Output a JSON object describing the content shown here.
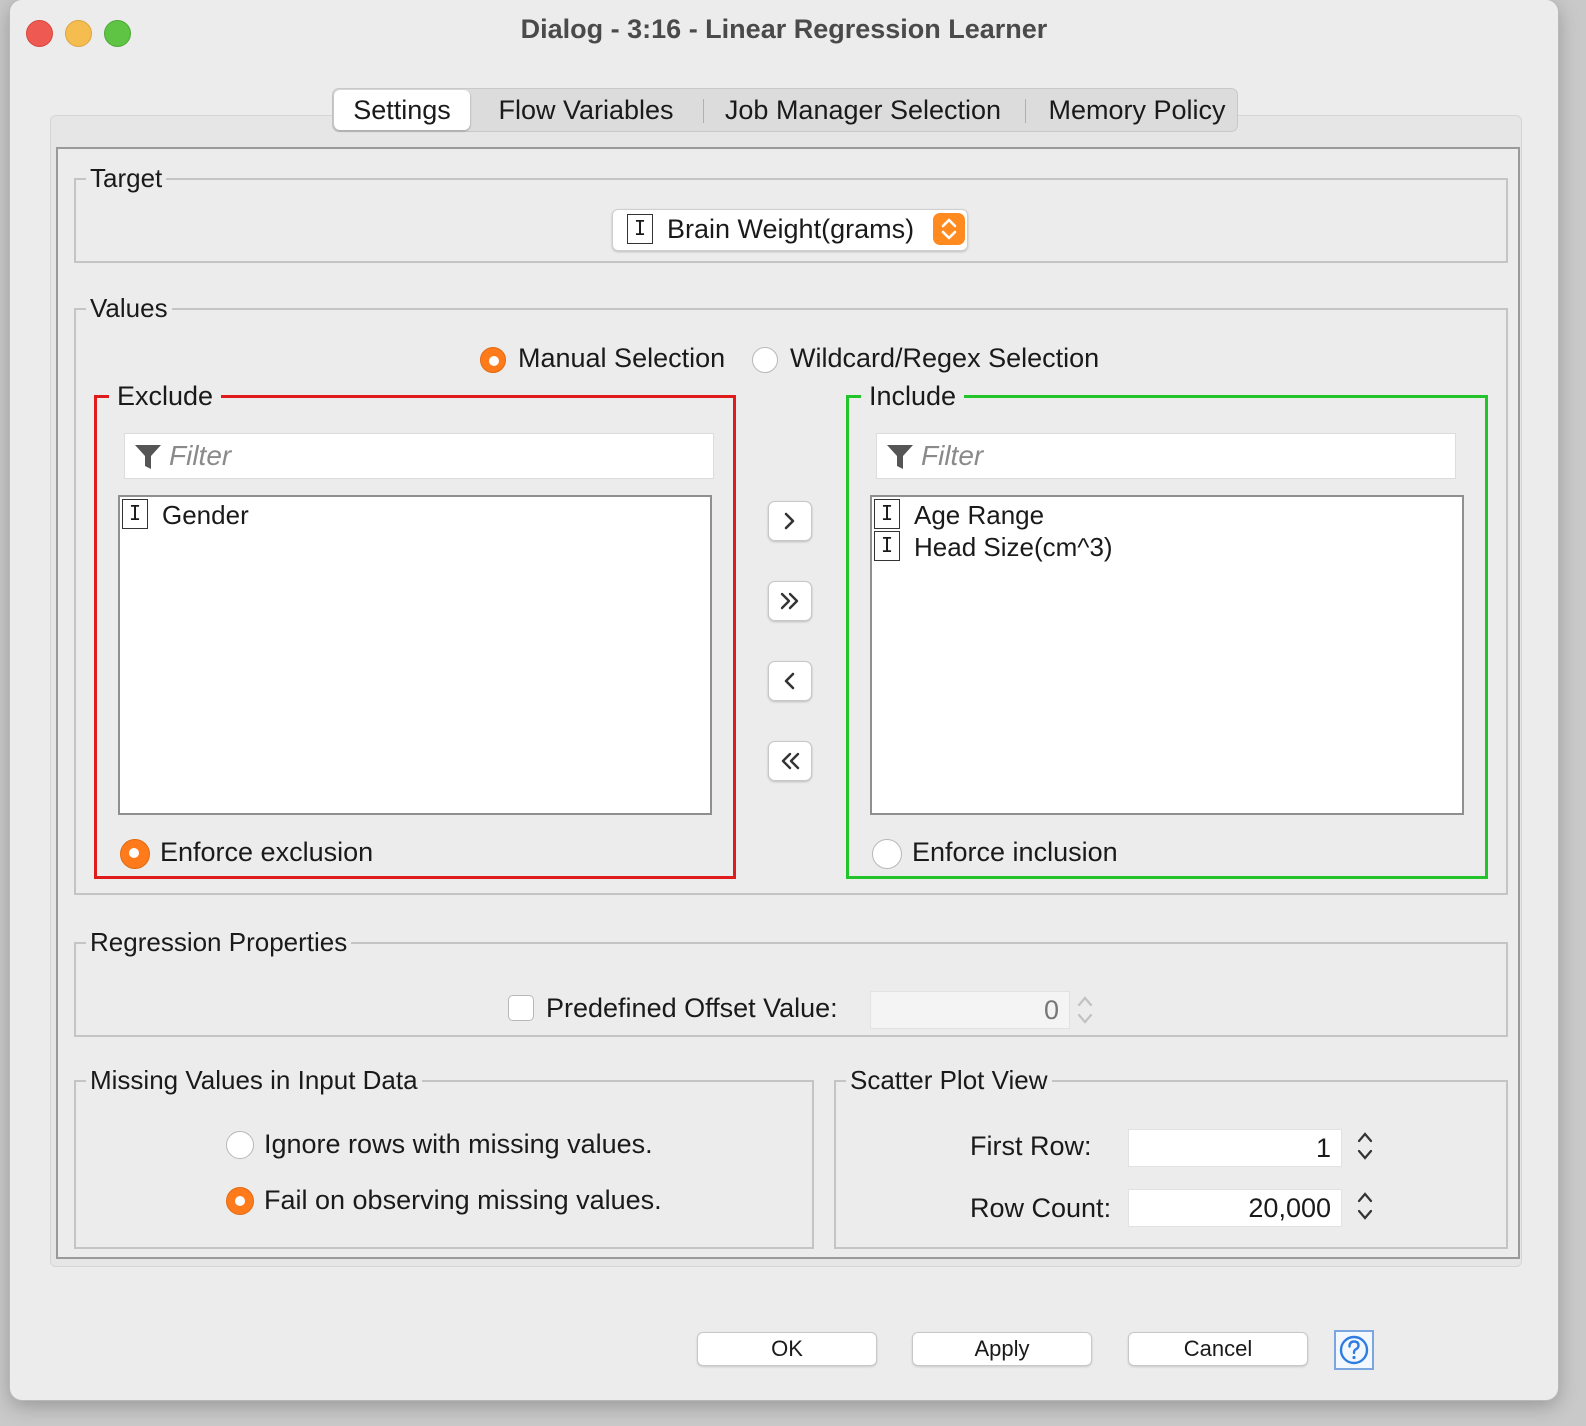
{
  "window": {
    "title": "Dialog - 3:16 - Linear Regression Learner",
    "colors": {
      "close": "#ee5a52",
      "minimize": "#f5bd4f",
      "zoom": "#5fc443"
    }
  },
  "tabs": [
    {
      "label": "Settings",
      "active": true
    },
    {
      "label": "Flow Variables",
      "active": false
    },
    {
      "label": "Job Manager Selection",
      "active": false
    },
    {
      "label": "Memory Policy",
      "active": false
    }
  ],
  "target": {
    "legend": "Target",
    "type_icon": "I",
    "selected": "Brain Weight(grams)"
  },
  "values": {
    "legend": "Values",
    "mode_options": [
      {
        "label": "Manual Selection",
        "selected": true
      },
      {
        "label": "Wildcard/Regex Selection",
        "selected": false
      }
    ],
    "exclude": {
      "legend": "Exclude",
      "filter_placeholder": "Filter",
      "items": [
        {
          "type_icon": "I",
          "label": "Gender"
        }
      ],
      "enforce_label": "Enforce exclusion",
      "enforce_selected": true,
      "border_color": "#e01b1b"
    },
    "include": {
      "legend": "Include",
      "filter_placeholder": "Filter",
      "items": [
        {
          "type_icon": "I",
          "label": "Age Range"
        },
        {
          "type_icon": "I",
          "label": "Head Size(cm^3)"
        }
      ],
      "enforce_label": "Enforce inclusion",
      "enforce_selected": false,
      "border_color": "#22c42a"
    },
    "move_buttons": [
      {
        "icon": "chevron-right-icon"
      },
      {
        "icon": "double-chevron-right-icon"
      },
      {
        "icon": "chevron-left-icon"
      },
      {
        "icon": "double-chevron-left-icon"
      }
    ]
  },
  "regression": {
    "legend": "Regression Properties",
    "offset_label": "Predefined Offset Value:",
    "offset_checked": false,
    "offset_value": "0"
  },
  "missing": {
    "legend": "Missing Values in Input Data",
    "options": [
      {
        "label": "Ignore rows with missing values.",
        "selected": false
      },
      {
        "label": "Fail on observing missing values.",
        "selected": true
      }
    ]
  },
  "scatter": {
    "legend": "Scatter Plot View",
    "first_row_label": "First Row:",
    "first_row_value": "1",
    "row_count_label": "Row Count:",
    "row_count_value": "20,000"
  },
  "buttons": {
    "ok": "OK",
    "apply": "Apply",
    "cancel": "Cancel",
    "help_icon": "question-circle-icon"
  },
  "accent_color": "#ff7a1a"
}
